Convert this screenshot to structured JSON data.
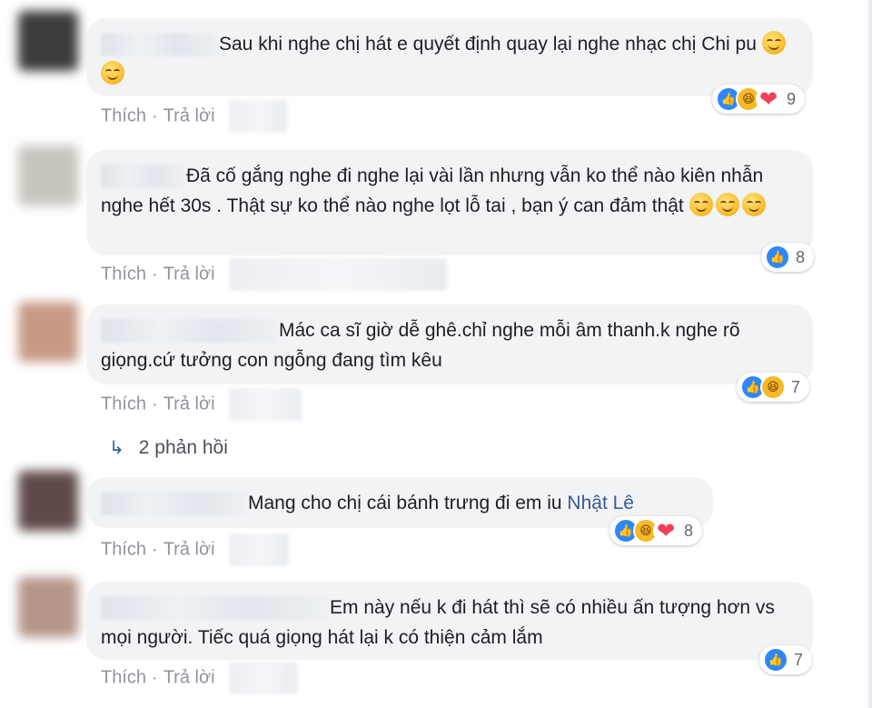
{
  "comments": [
    {
      "text": "Sau khi nghe chị hát e quyết định quay lại nghe nhạc chị Chi pu",
      "reactions": {
        "types": [
          "like",
          "haha",
          "love"
        ],
        "count": "9"
      },
      "actions": {
        "like": "Thích",
        "reply": "Trả lời"
      }
    },
    {
      "text": "Đã cố gắng nghe đi nghe lại vài lần nhưng vẫn ko thể nào kiên nhẫn nghe hết 30s . Thật sự ko thể nào nghe lọt lỗ tai , bạn ý can đảm thật",
      "reactions": {
        "types": [
          "like"
        ],
        "count": "8"
      },
      "actions": {
        "like": "Thích",
        "reply": "Trả lời"
      }
    },
    {
      "text": "Mác ca sĩ giờ dễ ghê.chỉ nghe mỗi âm thanh.k nghe rõ giọng.cứ tưởng con ngỗng đang tìm kêu",
      "reactions": {
        "types": [
          "like",
          "haha"
        ],
        "count": "7"
      },
      "actions": {
        "like": "Thích",
        "reply": "Trả lời"
      },
      "replies_label": "2 phản hồi"
    },
    {
      "text": "Mang cho chị cái bánh trưng đi em iu",
      "mention": "Nhật Lê",
      "reactions": {
        "types": [
          "like",
          "haha",
          "love"
        ],
        "count": "8"
      },
      "actions": {
        "like": "Thích",
        "reply": "Trả lời"
      }
    },
    {
      "text": "Em này nếu k đi hát thì sẽ có nhiều ấn tượng hơn vs mọi người. Tiếc quá giọng hát lại k có thiện cảm lắm",
      "reactions": {
        "types": [
          "like"
        ],
        "count": "7"
      },
      "actions": {
        "like": "Thích",
        "reply": "Trả lời"
      }
    }
  ],
  "icons": {
    "like": "thumbs-up-icon",
    "haha": "laughing-face-icon",
    "love": "heart-icon",
    "reply_arrow": "reply-arrow-icon"
  },
  "colors": {
    "bubble": "#f2f3f5",
    "link": "#385898",
    "meta": "#90949c",
    "like": "#2d88ff"
  }
}
